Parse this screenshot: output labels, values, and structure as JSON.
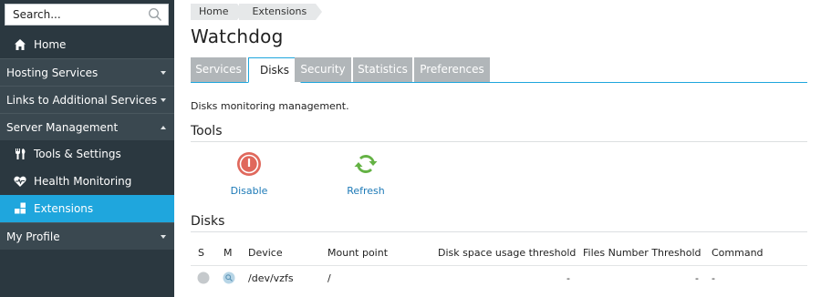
{
  "sidebar": {
    "search_placeholder": "Search...",
    "items": [
      {
        "label": "Home",
        "icon": "home-icon"
      },
      {
        "label": "Hosting Services",
        "expanded": false
      },
      {
        "label": "Links to Additional Services",
        "expanded": false
      },
      {
        "label": "Server Management",
        "expanded": true
      },
      {
        "label": "Tools & Settings",
        "icon": "tools-icon"
      },
      {
        "label": "Health Monitoring",
        "icon": "heart-monitor-icon"
      },
      {
        "label": "Extensions",
        "icon": "extensions-icon",
        "active": true
      },
      {
        "label": "My Profile",
        "expanded": false
      }
    ]
  },
  "breadcrumbs": [
    "Home",
    "Extensions"
  ],
  "page_title": "Watchdog",
  "tabs": [
    {
      "label": "Services",
      "active": false
    },
    {
      "label": "Disks",
      "active": true
    },
    {
      "label": "Security",
      "active": false
    },
    {
      "label": "Statistics",
      "active": false
    },
    {
      "label": "Preferences",
      "active": false
    }
  ],
  "description": "Disks monitoring management.",
  "tools": {
    "title": "Tools",
    "disable_label": "Disable",
    "refresh_label": "Refresh"
  },
  "disks": {
    "title": "Disks",
    "columns": [
      "S",
      "M",
      "Device",
      "Mount point",
      "Disk space usage threshold",
      "Files Number Threshold",
      "Command"
    ],
    "rows": [
      {
        "device": "/dev/vzfs",
        "mount_point": "/",
        "disk_space_threshold": "-",
        "files_number_threshold": "-",
        "command": "-"
      }
    ]
  },
  "colors": {
    "sidebar_bg": "#2b3840",
    "sidebar_group_bg": "#3a4850",
    "accent": "#1fa6dd",
    "link": "#1d7ab7",
    "tab_inactive": "#b1b6b9",
    "disable_red": "#e0685c",
    "refresh_green": "#64b244"
  }
}
